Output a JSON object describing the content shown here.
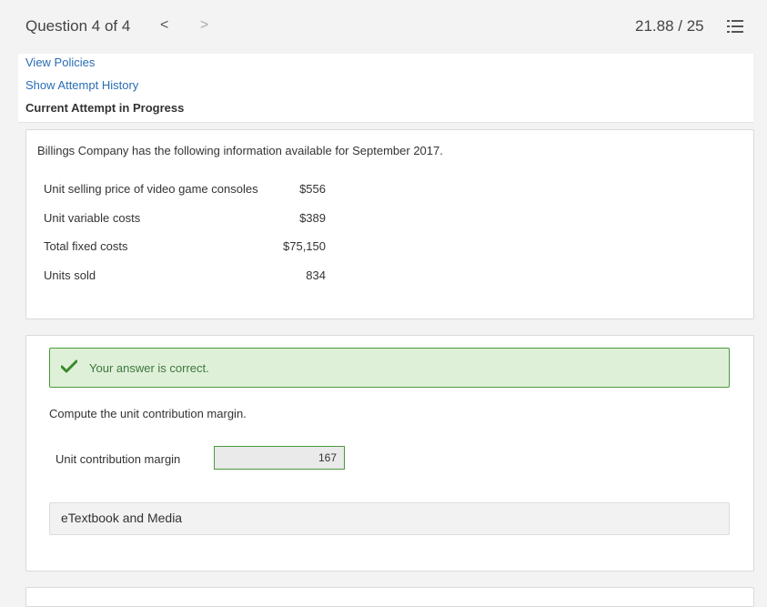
{
  "header": {
    "question_label": "Question 4 of 4",
    "prev_icon": "<",
    "next_icon": ">",
    "score": "21.88 / 25",
    "menu_icon": "list-icon"
  },
  "links": {
    "view_policies": "View Policies",
    "show_history": "Show Attempt History",
    "current_attempt": "Current Attempt in Progress"
  },
  "problem": {
    "intro": "Billings Company has the following information available for September 2017.",
    "rows": [
      {
        "label": "Unit selling price of video game consoles",
        "value": "$556"
      },
      {
        "label": "Unit variable costs",
        "value": "$389"
      },
      {
        "label": "Total fixed costs",
        "value": "$75,150"
      },
      {
        "label": "Units sold",
        "value": "834"
      }
    ]
  },
  "answer": {
    "status": "Your answer is correct.",
    "prompt": "Compute the unit contribution margin.",
    "field_label": "Unit contribution margin",
    "field_value": "167",
    "etextbook": "eTextbook and Media"
  },
  "colors": {
    "link": "#2a6db5",
    "success_bg": "#dff0d8",
    "success_border": "#4a9a3c",
    "check": "#3a8a2e"
  }
}
